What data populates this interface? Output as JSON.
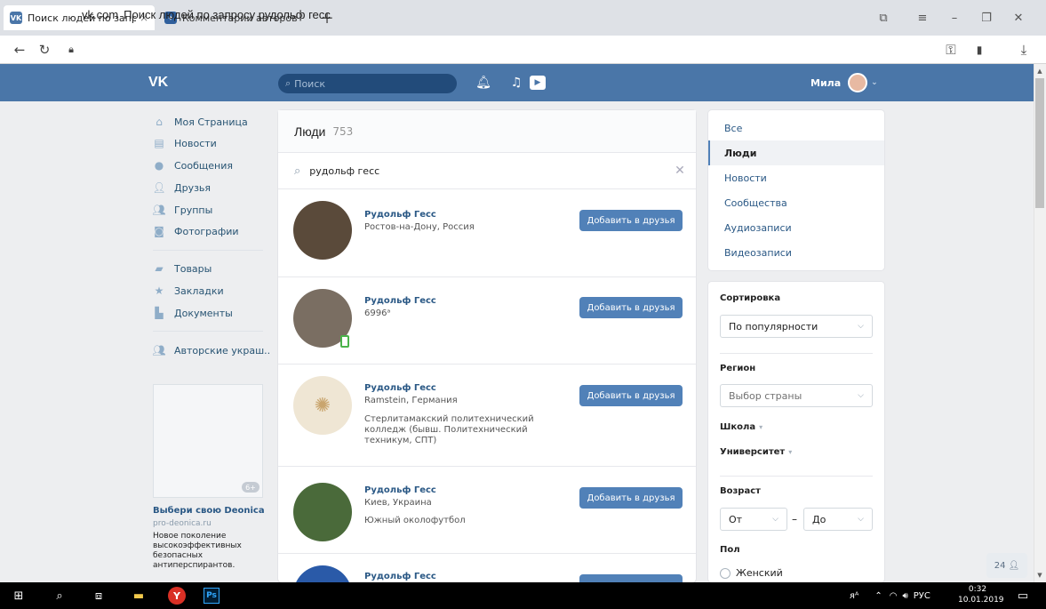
{
  "browser": {
    "tabs": [
      {
        "title": "Поиск людей по запро",
        "icon": "vk-icon",
        "active": true
      },
      {
        "title": "Комментарии авторов \"Со",
        "icon": "comment-icon",
        "active": false
      }
    ],
    "url_domain": "vk.com",
    "url_title": "Поиск людей по запросу рудольф гесс"
  },
  "header": {
    "logo": "VK",
    "search_placeholder": "Поиск",
    "user_name": "Мила"
  },
  "sidebar": {
    "items": [
      {
        "label": "Моя Страница",
        "icon": "home-icon"
      },
      {
        "label": "Новости",
        "icon": "news-icon"
      },
      {
        "label": "Сообщения",
        "icon": "messages-icon"
      },
      {
        "label": "Друзья",
        "icon": "friends-icon"
      },
      {
        "label": "Группы",
        "icon": "groups-icon"
      },
      {
        "label": "Фотографии",
        "icon": "photos-icon"
      },
      {
        "label": "Товары",
        "icon": "goods-icon"
      },
      {
        "label": "Закладки",
        "icon": "bookmarks-icon"
      },
      {
        "label": "Документы",
        "icon": "documents-icon"
      },
      {
        "label": "Авторские украш..",
        "icon": "group-icon"
      }
    ],
    "ad": {
      "badge": "6+",
      "title": "Выбери свою Deonica",
      "site": "pro-deonica.ru",
      "text": "Новое поколение высокоэффективных безопасных антиперспирантов."
    }
  },
  "main": {
    "heading": "Люди",
    "count": "753",
    "query": "рудольф гесс",
    "add_label": "Добавить в друзья",
    "people": [
      {
        "name": "Рудольф Гесс",
        "lines": [
          "Ростов-на-Дону, Россия"
        ],
        "avatar_color": "#5a4a3a",
        "mobile": false
      },
      {
        "name": "Рудольф Гесс",
        "lines": [
          "6996ᵃ"
        ],
        "avatar_color": "#7a6e62",
        "mobile": true
      },
      {
        "name": "Рудольф Гесс",
        "lines": [
          "Ramstein, Германия",
          "Стерлитамакский политехнический колледж (бывш. Политехнический техникум, СПТ)"
        ],
        "avatar_color": "#efe6d4",
        "mobile": false
      },
      {
        "name": "Рудольф Гесс",
        "lines": [
          "Киев, Украина",
          "Южный околофутбол"
        ],
        "avatar_color": "#4a6a3a",
        "mobile": false
      },
      {
        "name": "Рудольф Гесс",
        "lines": [],
        "avatar_color": "#2a5aa8",
        "mobile": false
      }
    ]
  },
  "filters": {
    "sections": [
      "Все",
      "Люди",
      "Новости",
      "Сообщества",
      "Аудиозаписи",
      "Видеозаписи"
    ],
    "selected": "Люди",
    "sort_label": "Сортировка",
    "sort_value": "По популярности",
    "region_label": "Регион",
    "region_placeholder": "Выбор страны",
    "school_label": "Школа",
    "university_label": "Университет",
    "age_label": "Возраст",
    "age_from": "От",
    "age_dash": "–",
    "age_to": "До",
    "gender_label": "Пол",
    "gender_female": "Женский",
    "friends_badge": "24"
  },
  "taskbar": {
    "lang": "РУС",
    "time": "0:32",
    "date": "10.01.2019"
  }
}
